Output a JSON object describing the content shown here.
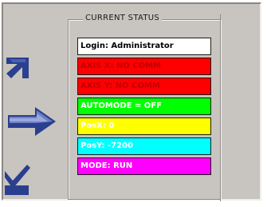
{
  "status_panel": {
    "title": "CURRENT STATUS",
    "rows": [
      {
        "text": "Login: Administrator",
        "bg": "#ffffff",
        "fg": "#000000"
      },
      {
        "text": "AXIS X: NO COMM",
        "bg": "#ff0000",
        "fg": "#c00000"
      },
      {
        "text": "AXIS Y: NO COMM",
        "bg": "#ff0000",
        "fg": "#c00000"
      },
      {
        "text": "AUTOMODE = OFF",
        "bg": "#00ff00",
        "fg": "#ffffff"
      },
      {
        "text": "PosX: 0",
        "bg": "#ffff00",
        "fg": "#ffffff"
      },
      {
        "text": "PosY: -7200",
        "bg": "#00ffff",
        "fg": "#ffffff"
      },
      {
        "text": "MODE: RUN",
        "bg": "#ff00ff",
        "fg": "#ffffff"
      }
    ]
  },
  "icons": [
    "move-up-left-icon",
    "move-right-icon",
    "confirm-check-icon"
  ],
  "colors": {
    "panel": "#c8c4bf",
    "arrow": "#2b3f8f"
  }
}
